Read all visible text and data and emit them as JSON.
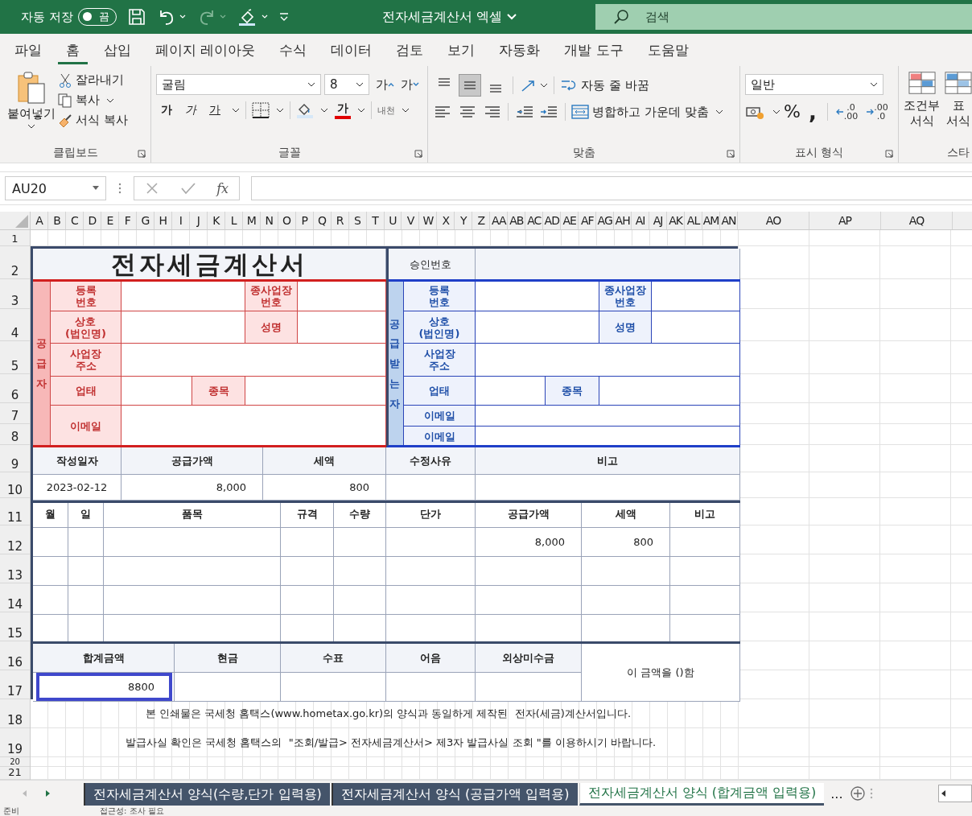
{
  "title_bar": {
    "autosave_label": "자동 저장",
    "autosave_toggle": "끔",
    "autosave_on": false,
    "document_title": "전자세금계산서 엑셀",
    "search_placeholder": "검색"
  },
  "menu_tabs": [
    {
      "label": "파일",
      "selected": false
    },
    {
      "label": "홈",
      "selected": true
    },
    {
      "label": "삽입",
      "selected": false
    },
    {
      "label": "페이지 레이아웃",
      "selected": false
    },
    {
      "label": "수식",
      "selected": false
    },
    {
      "label": "데이터",
      "selected": false
    },
    {
      "label": "검토",
      "selected": false
    },
    {
      "label": "보기",
      "selected": false
    },
    {
      "label": "자동화",
      "selected": false
    },
    {
      "label": "개발 도구",
      "selected": false
    },
    {
      "label": "도움말",
      "selected": false
    }
  ],
  "ribbon": {
    "clipboard": {
      "paste": "붙여넣기",
      "cut": "잘라내기",
      "copy": "복사",
      "format_painter": "서식 복사",
      "label": "클립보드"
    },
    "font": {
      "font_name": "굴림",
      "font_size": "8",
      "size_buttons": [
        {
          "kind": "grow",
          "label": "가"
        },
        {
          "kind": "shrink",
          "label": "가"
        }
      ],
      "format_buttons": [
        {
          "kind": "bold",
          "label": "가"
        },
        {
          "kind": "italic",
          "label": "가"
        },
        {
          "kind": "underline",
          "label": "가"
        }
      ],
      "font_color": "가",
      "phonetic": "내천",
      "label": "글꼴"
    },
    "alignment": {
      "vertical_buttons": [
        {
          "kind": "top",
          "selected": false
        },
        {
          "kind": "middle",
          "selected": true
        },
        {
          "kind": "bottom",
          "selected": false
        }
      ],
      "wrap_text": "자동 줄 바꿈",
      "merge_center": "병합하고 가운데 맞춤",
      "label": "맞춤"
    },
    "number": {
      "format": "일반",
      "percent": "%",
      "comma": ",",
      "decimal_buttons": [
        {
          "kind": "increase",
          "top": ".0",
          "bottom": ".00"
        },
        {
          "kind": "decrease",
          "top": ".00",
          "bottom": ".0"
        }
      ],
      "label": "표시 형식"
    },
    "styles": {
      "buttons": [
        "조건부\n서식",
        "표\n서식"
      ],
      "label": "스타"
    }
  },
  "formula_bar": {
    "name_box": "AU20",
    "fx": "fx"
  },
  "column_headers": [
    "A",
    "B",
    "C",
    "D",
    "E",
    "F",
    "G",
    "H",
    "I",
    "J",
    "K",
    "L",
    "M",
    "N",
    "O",
    "P",
    "Q",
    "R",
    "S",
    "T",
    "U",
    "V",
    "W",
    "X",
    "Y",
    "Z",
    "AA",
    "AB",
    "AC",
    "AD",
    "AE",
    "AF",
    "AG",
    "AH",
    "AI",
    "AJ",
    "AK",
    "AL",
    "AM",
    "AN"
  ],
  "wide_column_headers": [
    "AO",
    "AP",
    "AQ"
  ],
  "row_numbers": [
    "1",
    "2",
    "3",
    "4",
    "5",
    "6",
    "7",
    "8",
    "9",
    "10",
    "11",
    "12",
    "13",
    "14",
    "15",
    "16",
    "17",
    "18",
    "19",
    "20",
    "21"
  ],
  "invoice": {
    "title": "전자세금계산서",
    "approval_label": "승인번호",
    "supplier": {
      "side_label": "공급자",
      "labels": [
        "등록\n번호",
        "종사업장\n번호",
        "상호\n(법인명)",
        "성명",
        "사업장\n주소",
        "업태",
        "종목",
        "이메일"
      ]
    },
    "buyer": {
      "side_label": "공급받는자",
      "labels": [
        "등록\n번호",
        "종사업장\n번호",
        "상호\n(법인명)",
        "성명",
        "사업장\n주소",
        "업태",
        "종목",
        "이메일",
        "이메일"
      ]
    },
    "summary": {
      "headers": [
        "작성일자",
        "공급가액",
        "세액",
        "수정사유",
        "비고"
      ],
      "values": [
        "2023-02-12",
        "8,000",
        "800"
      ]
    },
    "items": {
      "headers": [
        "월",
        "일",
        "품목",
        "규격",
        "수량",
        "단가",
        "공급가액",
        "세액",
        "비고"
      ],
      "rows": [
        {
          "supply_amount": "8,000",
          "tax": "800"
        }
      ]
    },
    "payment": {
      "headers": [
        "합계금액",
        "현금",
        "수표",
        "어음",
        "외상미수금"
      ],
      "total": "8800",
      "note": "이 금액을 ()함"
    }
  },
  "notes": [
    "본 인쇄물은 국세청 홈택스(www.hometax.go.kr)의 양식과 동일하게 제작된  전자(세금)계산서입니다.",
    "발급사실 확인은 국세청 홈택스의  \"조회/발급> 전자세금계산서> 제3자 발급사실 조회 \"를 이용하시기 바랍니다."
  ],
  "sheet_tabs": [
    {
      "label": "전자세금계산서 양식(수량,단가 입력용)",
      "selected": false,
      "color": "#44546a"
    },
    {
      "label": "전자세금계산서 양식 (공급가액 입력용)",
      "selected": false,
      "color": "#44546a"
    },
    {
      "label": "전자세금계산서 양식 (합계금액 입력용)",
      "selected": true,
      "color": "#44546a"
    }
  ],
  "more_tabs": "...",
  "status_bar": {
    "ready": "준비",
    "accessibility": "접근성: 조사 필요"
  }
}
